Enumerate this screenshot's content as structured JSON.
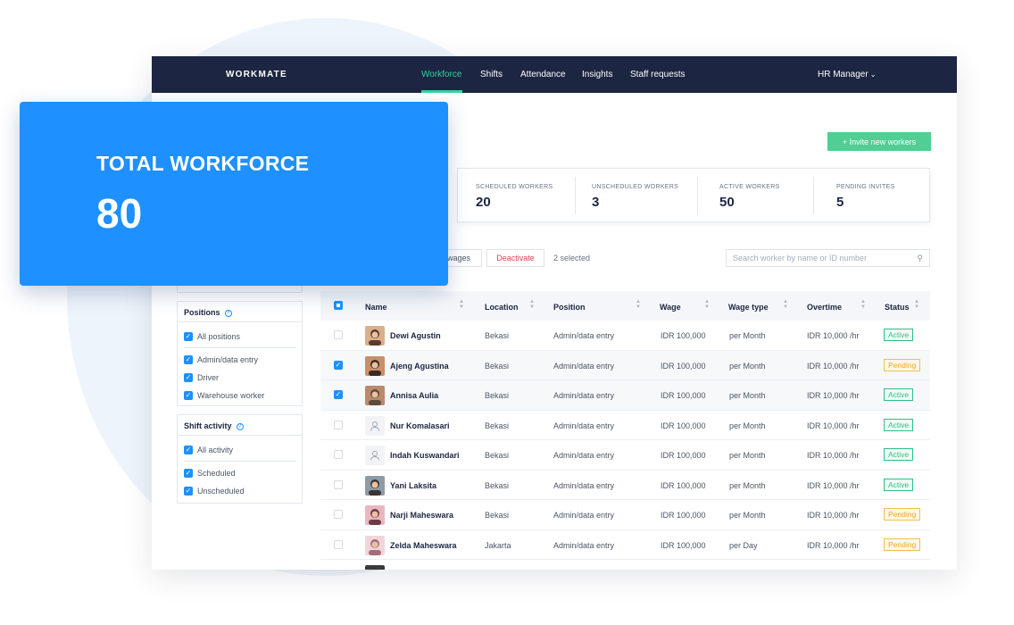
{
  "app": {
    "logo": "WORKMATE"
  },
  "nav": {
    "items": [
      "Workforce",
      "Shifts",
      "Attendance",
      "Insights",
      "Staff requests"
    ],
    "active": "Workforce",
    "role": "HR Manager"
  },
  "actions": {
    "invite": "+ Invite new workers"
  },
  "stats": [
    {
      "label": "SCHEDULED WORKERS",
      "value": "20"
    },
    {
      "label": "UNSCHEDULED WORKERS",
      "value": "3"
    },
    {
      "label": "ACTIVE WORKERS",
      "value": "50"
    },
    {
      "label": "PENDING INVITES",
      "value": "5"
    }
  ],
  "toolbar": {
    "wages": "wages",
    "deactivate": "Deactivate",
    "selected": "2 selected"
  },
  "search": {
    "placeholder": "Search worker by name or ID number"
  },
  "filters": {
    "positions": {
      "title": "Positions",
      "all": "All positions",
      "options": [
        "Admin/data entry",
        "Driver",
        "Warehouse worker"
      ]
    },
    "shift_activity": {
      "title": "Shift activity",
      "all": "All activity",
      "options": [
        "Scheduled",
        "Unscheduled"
      ]
    }
  },
  "table": {
    "columns": [
      "Name",
      "Location",
      "Position",
      "Wage",
      "Wage type",
      "Overtime",
      "Status"
    ],
    "rows": [
      {
        "name": "Dewi Agustin",
        "location": "Bekasi",
        "position": "Admin/data entry",
        "wage": "IDR 100,000",
        "wage_type": "per Month",
        "overtime": "IDR 10,000 /hr",
        "status": "Active",
        "selected": false,
        "avatar": "photo"
      },
      {
        "name": "Ajeng Agustina",
        "location": "Bekasi",
        "position": "Admin/data entry",
        "wage": "IDR 100,000",
        "wage_type": "per Month",
        "overtime": "IDR 10,000 /hr",
        "status": "Pending",
        "selected": true,
        "avatar": "photo"
      },
      {
        "name": "Annisa Aulia",
        "location": "Bekasi",
        "position": "Admin/data entry",
        "wage": "IDR 100,000",
        "wage_type": "per Month",
        "overtime": "IDR 10,000 /hr",
        "status": "Active",
        "selected": true,
        "avatar": "photo"
      },
      {
        "name": "Nur Komalasari",
        "location": "Bekasi",
        "position": "Admin/data entry",
        "wage": "IDR 100,000",
        "wage_type": "per Month",
        "overtime": "IDR 10,000 /hr",
        "status": "Active",
        "selected": false,
        "avatar": "placeholder"
      },
      {
        "name": "Indah Kuswandari",
        "location": "Bekasi",
        "position": "Admin/data entry",
        "wage": "IDR 100,000",
        "wage_type": "per Month",
        "overtime": "IDR 10,000 /hr",
        "status": "Active",
        "selected": false,
        "avatar": "placeholder"
      },
      {
        "name": "Yani Laksita",
        "location": "Bekasi",
        "position": "Admin/data entry",
        "wage": "IDR 100,000",
        "wage_type": "per Month",
        "overtime": "IDR 10,000 /hr",
        "status": "Active",
        "selected": false,
        "avatar": "photo"
      },
      {
        "name": "Narji Maheswara",
        "location": "Bekasi",
        "position": "Admin/data entry",
        "wage": "IDR 100,000",
        "wage_type": "per Month",
        "overtime": "IDR 10,000 /hr",
        "status": "Pending",
        "selected": false,
        "avatar": "photo"
      },
      {
        "name": "Zelda Maheswara",
        "location": "Jakarta",
        "position": "Admin/data entry",
        "wage": "IDR 100,000",
        "wage_type": "per Day",
        "overtime": "IDR 10,000 /hr",
        "status": "Pending",
        "selected": false,
        "avatar": "photo"
      }
    ]
  },
  "overlay": {
    "title": "TOTAL WORKFORCE",
    "value": "80"
  },
  "colors": {
    "nav_bg": "#1c2541",
    "accent_green": "#3ad29f",
    "brand_blue": "#1e90ff",
    "active": "#2fbf86",
    "pending": "#e8a92b",
    "deactivate": "#e0424f"
  }
}
